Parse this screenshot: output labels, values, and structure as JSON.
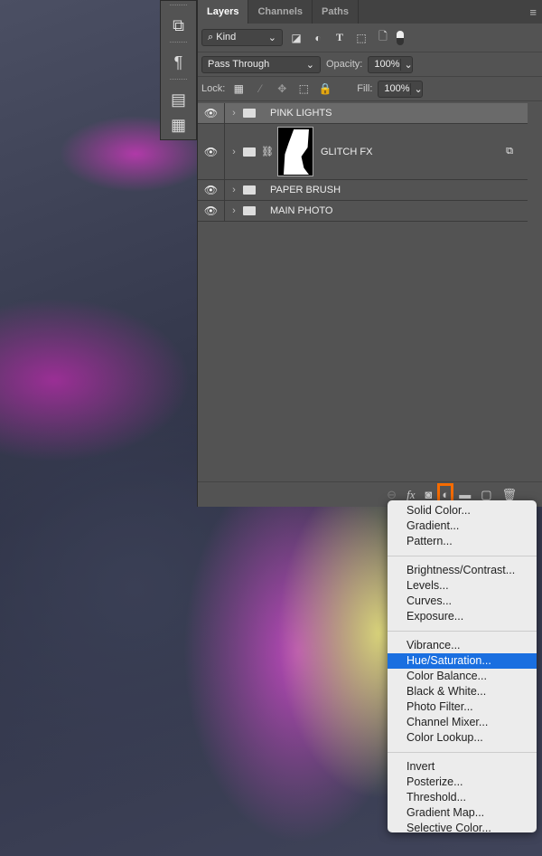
{
  "tools": [
    {
      "icon": "transform-icon",
      "glyph": "⧉"
    },
    {
      "icon": "paragraph-icon",
      "glyph": "¶"
    },
    {
      "icon": "layout-icon",
      "glyph": "▤"
    },
    {
      "icon": "notes-icon",
      "glyph": "▦"
    }
  ],
  "tabs": [
    "Layers",
    "Channels",
    "Paths"
  ],
  "filter": {
    "kind": "Kind",
    "icons": [
      "◪",
      "◐",
      "T",
      "⬚",
      "🗋"
    ]
  },
  "blend": {
    "mode": "Pass Through",
    "opacity_label": "Opacity:",
    "opacity": "100%"
  },
  "lock": {
    "label": "Lock:",
    "fill_label": "Fill:",
    "fill": "100%"
  },
  "layers": [
    {
      "name": "PINK LIGHTS",
      "selected": true
    },
    {
      "name": "GLITCH FX",
      "mask": true
    },
    {
      "name": "PAPER BRUSH"
    },
    {
      "name": "MAIN PHOTO"
    }
  ],
  "bottom_icons": [
    "link-icon",
    "fx-icon",
    "mask-icon",
    "adjustment-icon",
    "folder-icon",
    "new-layer-icon",
    "trash-icon"
  ],
  "bottom_glyphs": [
    "⊖",
    "fx",
    "◙",
    "◐",
    "▬",
    "▢",
    "🗑"
  ],
  "highlight_color": "#f56b00",
  "menu": {
    "groups": [
      [
        "Solid Color...",
        "Gradient...",
        "Pattern..."
      ],
      [
        "Brightness/Contrast...",
        "Levels...",
        "Curves...",
        "Exposure..."
      ],
      [
        "Vibrance...",
        "Hue/Saturation...",
        "Color Balance...",
        "Black & White...",
        "Photo Filter...",
        "Channel Mixer...",
        "Color Lookup..."
      ],
      [
        "Invert",
        "Posterize...",
        "Threshold...",
        "Gradient Map...",
        "Selective Color..."
      ]
    ],
    "active": "Hue/Saturation..."
  }
}
